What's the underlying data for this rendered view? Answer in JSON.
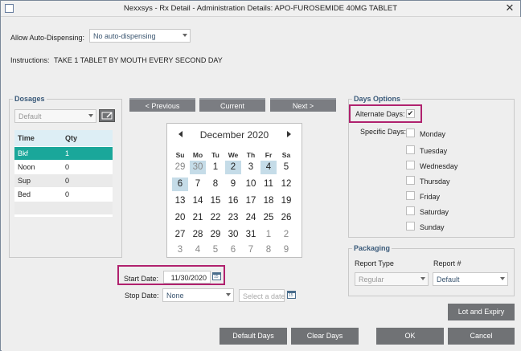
{
  "window": {
    "title": "Nexxsys - Rx Detail - Administration Details: APO-FUROSEMIDE 40MG TABLET",
    "close_glyph": "✕"
  },
  "auto_dispensing": {
    "label": "Allow Auto-Dispensing:",
    "value": "No auto-dispensing"
  },
  "instructions": {
    "label": "Instructions:",
    "text": "TAKE 1 TABLET BY MOUTH EVERY SECOND DAY"
  },
  "dosages": {
    "title": "Dosages",
    "preset": "Default",
    "columns": [
      "Time",
      "Qty"
    ],
    "rows": [
      {
        "time": "Bkf",
        "qty": "1"
      },
      {
        "time": "Noon",
        "qty": "0"
      },
      {
        "time": "Sup",
        "qty": "0"
      },
      {
        "time": "Bed",
        "qty": "0"
      }
    ]
  },
  "calendar_nav": {
    "previous": "< Previous",
    "current": "Current",
    "next": "Next >"
  },
  "calendar": {
    "month": "December 2020",
    "weekdays": [
      "Su",
      "Mo",
      "Tu",
      "We",
      "Th",
      "Fr",
      "Sa"
    ],
    "weeks": [
      [
        "29",
        "30",
        "1",
        "2",
        "3",
        "4",
        "5"
      ],
      [
        "6",
        "7",
        "8",
        "9",
        "10",
        "11",
        "12"
      ],
      [
        "13",
        "14",
        "15",
        "16",
        "17",
        "18",
        "19"
      ],
      [
        "20",
        "21",
        "22",
        "23",
        "24",
        "25",
        "26"
      ],
      [
        "27",
        "28",
        "29",
        "30",
        "31",
        "1",
        "2"
      ],
      [
        "3",
        "4",
        "5",
        "6",
        "7",
        "8",
        "9"
      ]
    ]
  },
  "start_date": {
    "label": "Start Date:",
    "value": "11/30/2020"
  },
  "stop_date": {
    "label": "Stop Date:",
    "value": "None",
    "placeholder": "Select a date"
  },
  "days_options": {
    "title": "Days Options",
    "alternate_label": "Alternate Days:",
    "alternate_checked": "✔",
    "specific_label": "Specific Days:",
    "days": [
      "Monday",
      "Tuesday",
      "Wednesday",
      "Thursday",
      "Friday",
      "Saturday",
      "Sunday"
    ]
  },
  "packaging": {
    "title": "Packaging",
    "report_type_label": "Report Type",
    "report_type_value": "Regular",
    "report_num_label": "Report #",
    "report_num_value": "Default"
  },
  "buttons": {
    "lot_expiry": "Lot and Expiry",
    "default_days": "Default Days",
    "clear_days": "Clear Days",
    "ok": "OK",
    "cancel": "Cancel"
  },
  "colors": {
    "selection": "#1aa79a",
    "highlight": "#b0216e",
    "button": "#707275"
  }
}
